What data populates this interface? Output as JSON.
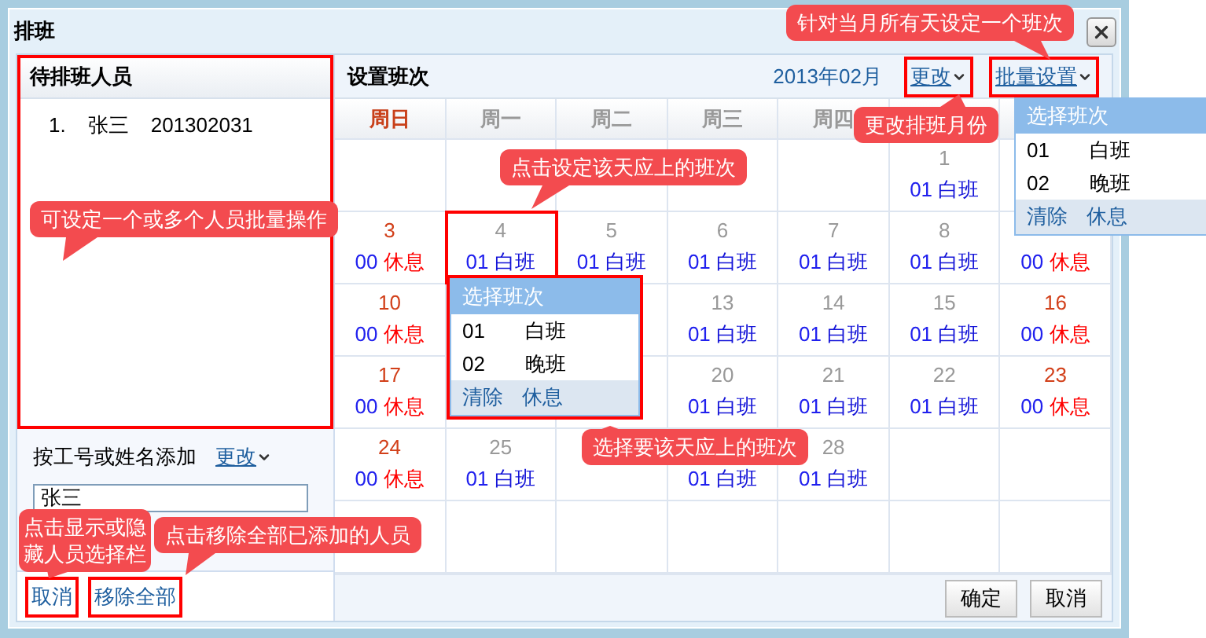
{
  "dialog": {
    "title": "排班"
  },
  "staff_panel": {
    "title": "待排班人员",
    "members": [
      {
        "index": "1.",
        "name": "张三",
        "id": "201302031"
      }
    ],
    "add_label": "按工号或姓名添加",
    "change_link": "更改",
    "input_value": "张三",
    "footer_links": [
      "取消",
      "移除全部"
    ]
  },
  "schedule": {
    "title": "设置班次",
    "month": "2013年02月",
    "change_link": "更改",
    "batch_link": "批量设置",
    "weekdays": [
      {
        "label": "周日",
        "weekend": true
      },
      {
        "label": "周一",
        "weekend": false
      },
      {
        "label": "周二",
        "weekend": false
      },
      {
        "label": "周三",
        "weekend": false
      },
      {
        "label": "周四",
        "weekend": false
      }
    ],
    "weeks": [
      [
        {
          "kind": "blank"
        },
        {
          "kind": "blank"
        },
        {
          "kind": "blank"
        },
        {
          "kind": "blank"
        },
        {
          "kind": "blank"
        },
        {
          "day": "1",
          "code": "01",
          "shift": "白班",
          "kind": "work"
        }
      ],
      [
        {
          "day": "3",
          "code": "00",
          "shift": "休息",
          "kind": "rest"
        },
        {
          "day": "4",
          "code": "01",
          "shift": "白班",
          "kind": "work"
        },
        {
          "day": "5",
          "code": "01",
          "shift": "白班",
          "kind": "work"
        },
        {
          "day": "6",
          "code": "01",
          "shift": "白班",
          "kind": "work"
        },
        {
          "day": "7",
          "code": "01",
          "shift": "白班",
          "kind": "work"
        },
        {
          "day": "8",
          "code": "01",
          "shift": "白班",
          "kind": "work"
        },
        {
          "code": "00",
          "shift": "休息",
          "kind": "rest"
        }
      ],
      [
        {
          "day": "10",
          "code": "00",
          "shift": "休息",
          "kind": "rest"
        },
        {
          "kind": "covered"
        },
        {
          "kind": "blank"
        },
        {
          "day": "13",
          "code": "01",
          "shift": "白班",
          "kind": "work"
        },
        {
          "day": "14",
          "code": "01",
          "shift": "白班",
          "kind": "work"
        },
        {
          "day": "15",
          "code": "01",
          "shift": "白班",
          "kind": "work"
        },
        {
          "day": "16",
          "code": "00",
          "shift": "休息",
          "kind": "rest"
        }
      ],
      [
        {
          "day": "17",
          "code": "00",
          "shift": "休息",
          "kind": "rest"
        },
        {
          "kind": "blank"
        },
        {
          "kind": "blank"
        },
        {
          "day": "20",
          "code": "01",
          "shift": "白班",
          "kind": "work"
        },
        {
          "day": "21",
          "code": "01",
          "shift": "白班",
          "kind": "work"
        },
        {
          "day": "22",
          "code": "01",
          "shift": "白班",
          "kind": "work"
        },
        {
          "day": "23",
          "code": "00",
          "shift": "休息",
          "kind": "rest"
        }
      ],
      [
        {
          "day": "24",
          "code": "00",
          "shift": "休息",
          "kind": "rest"
        },
        {
          "day": "25",
          "code": "01",
          "shift": "白班",
          "kind": "work"
        },
        {
          "kind": "blank"
        },
        {
          "code": "01",
          "shift": "白班",
          "kind": "work"
        },
        {
          "day": "28",
          "code": "01",
          "shift": "白班",
          "kind": "work"
        }
      ]
    ],
    "buttons": [
      "确定",
      "取消"
    ]
  },
  "day_picker": {
    "title": "选择班次",
    "options": [
      {
        "code": "01",
        "name": "白班"
      },
      {
        "code": "02",
        "name": "晚班"
      }
    ],
    "actions": [
      "清除",
      "休息"
    ]
  },
  "batch_picker": {
    "title": "选择班次",
    "options": [
      {
        "code": "01",
        "name": "白班"
      },
      {
        "code": "02",
        "name": "晚班"
      }
    ],
    "actions": [
      "清除",
      "休息"
    ]
  },
  "callouts": [
    "针对当月所有天设定一个班次",
    "更改排班月份",
    "点击设定该天应上的班次",
    "可设定一个或多个人员批量操作",
    "选择要该天应上的班次",
    "点击显示或隐藏人员选择栏",
    "点击移除全部已添加的人员"
  ]
}
